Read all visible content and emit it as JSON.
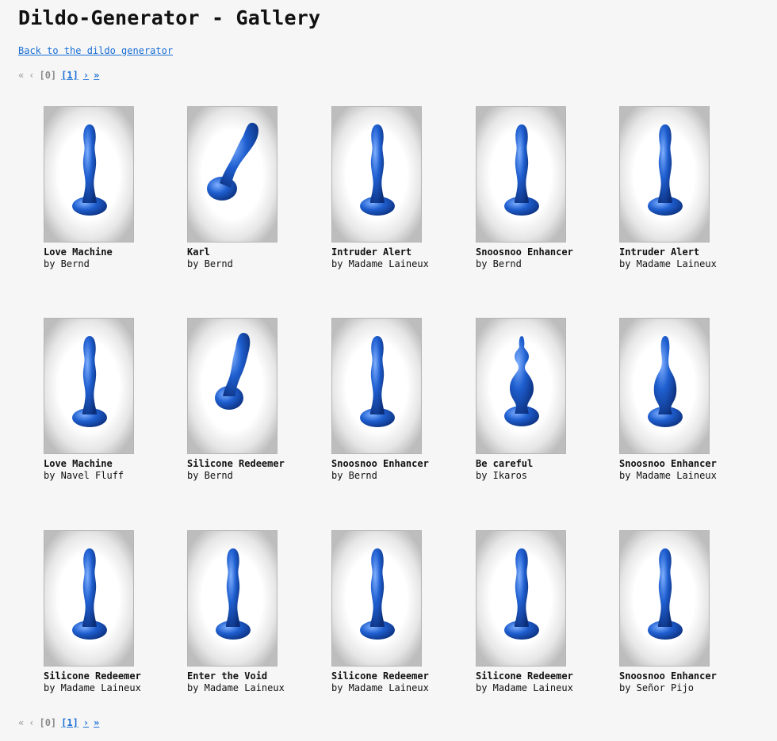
{
  "page": {
    "title": "Dildo-Generator - Gallery",
    "back_link": "Back to the dildo generator"
  },
  "pager": {
    "first": "«",
    "prev": "‹",
    "page0": "[0]",
    "page1": "[1]",
    "next": "›",
    "last": "»"
  },
  "accent_color": "#1a6fd6",
  "model_color": "#1f5fd0",
  "gallery": [
    {
      "title": "Love Machine",
      "author": "by Bernd",
      "shape": "straight"
    },
    {
      "title": "Karl",
      "author": "by Bernd",
      "shape": "tilted-strong"
    },
    {
      "title": "Intruder Alert",
      "author": "by Madame Laineux",
      "shape": "straight"
    },
    {
      "title": "Snoosnoo Enhancer",
      "author": "by Bernd",
      "shape": "straight"
    },
    {
      "title": "Intruder Alert",
      "author": "by Madame Laineux",
      "shape": "straight"
    },
    {
      "title": "Love Machine",
      "author": "by Navel Fluff",
      "shape": "straight"
    },
    {
      "title": "Silicone Redeemer",
      "author": "by Bernd",
      "shape": "tilted"
    },
    {
      "title": "Snoosnoo Enhancer",
      "author": "by Bernd",
      "shape": "straight"
    },
    {
      "title": "Be careful",
      "author": "by Ikaros",
      "shape": "bulb"
    },
    {
      "title": "Snoosnoo Enhancer",
      "author": "by Madame Laineux",
      "shape": "bulb-soft"
    },
    {
      "title": "Silicone Redeemer",
      "author": "by Madame Laineux",
      "shape": "straight"
    },
    {
      "title": "Enter the Void",
      "author": "by Madame Laineux",
      "shape": "straight"
    },
    {
      "title": "Silicone Redeemer",
      "author": "by Madame Laineux",
      "shape": "straight"
    },
    {
      "title": "Silicone Redeemer",
      "author": "by Madame Laineux",
      "shape": "straight"
    },
    {
      "title": "Snoosnoo Enhancer",
      "author": "by Señor Pijo",
      "shape": "straight"
    }
  ]
}
